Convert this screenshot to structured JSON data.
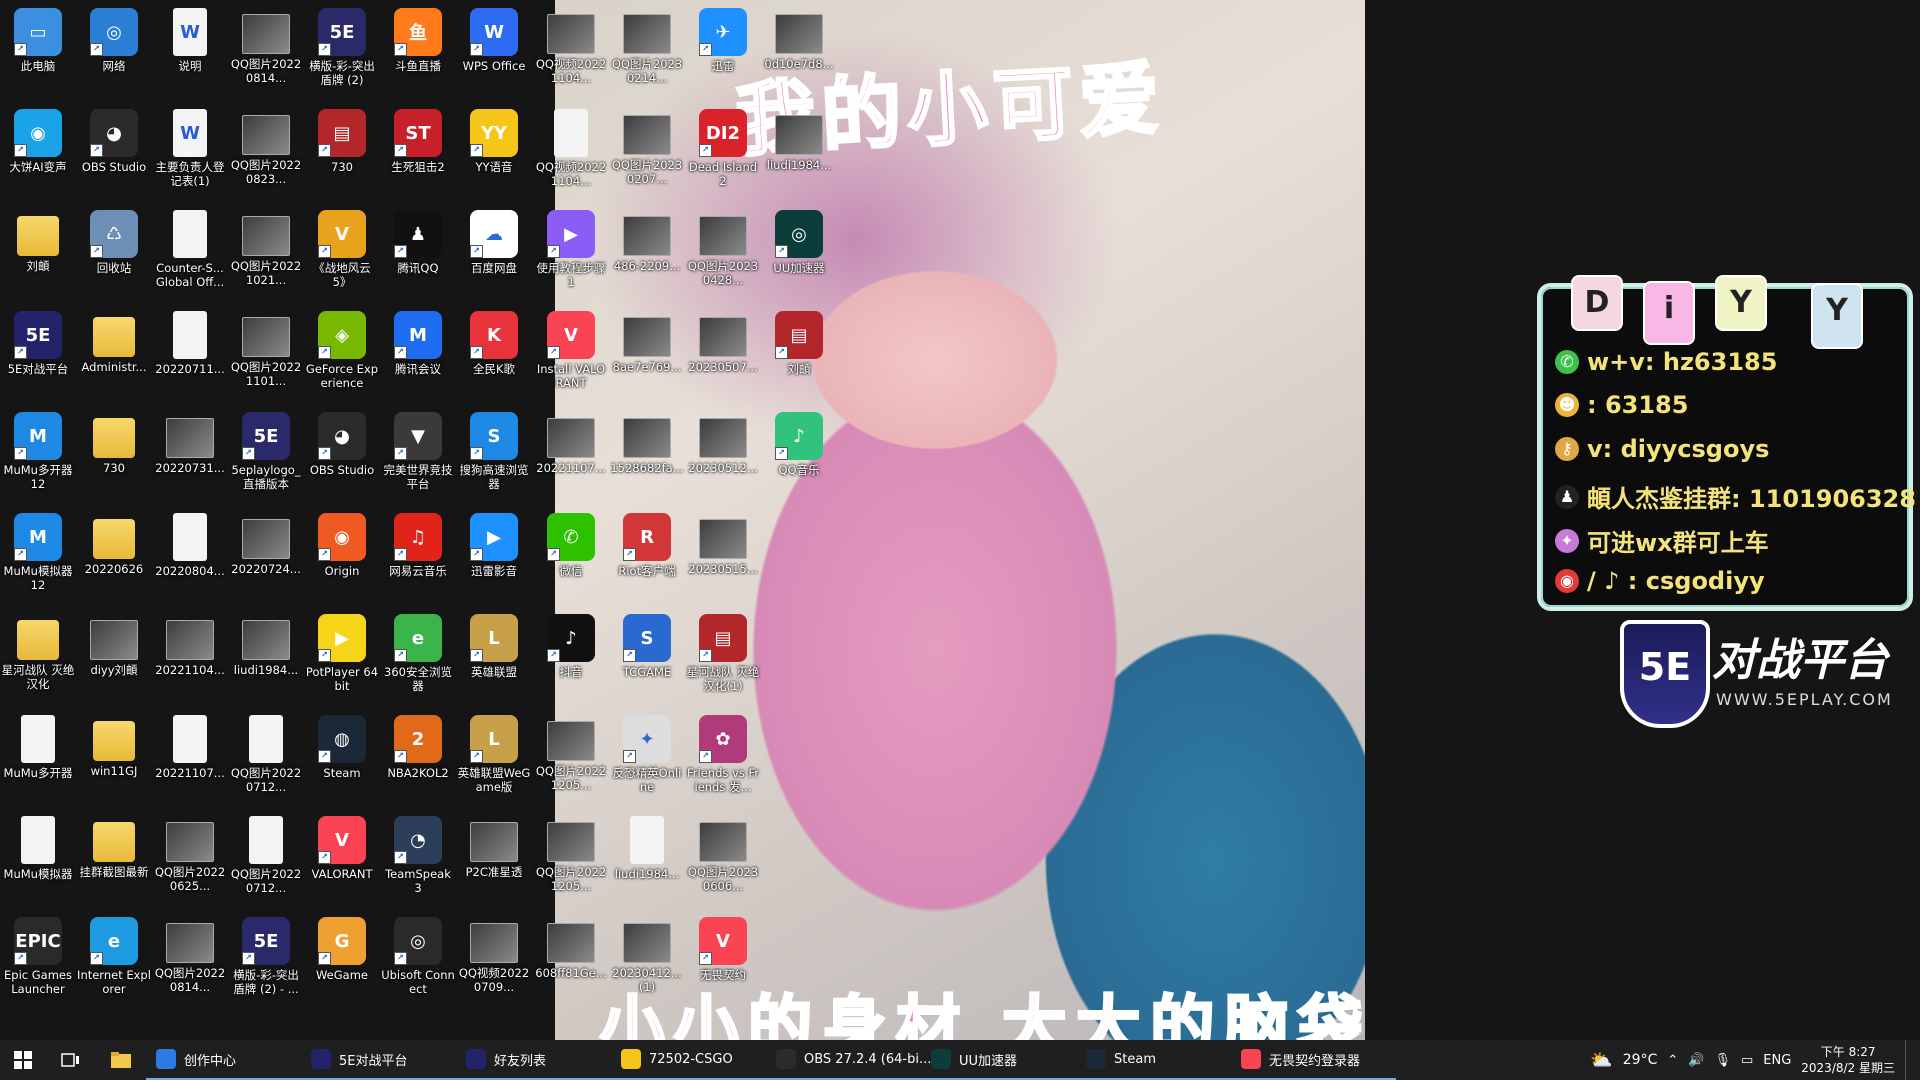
{
  "wallpaper": {
    "caption_top": "我的小可爱",
    "caption_bottom": "小小的身材 大大的脑袋"
  },
  "overlay": {
    "tags": [
      "D",
      "i",
      "Y",
      "Y"
    ],
    "tag_colors": [
      "#f5d7e3",
      "#f7b8e6",
      "#f0f4c4",
      "#cfe3f1"
    ],
    "lines": [
      {
        "icon": "wechat-icon",
        "color": "#3cc24a",
        "glyph": "✆",
        "text": "w+v:  hz63185"
      },
      {
        "icon": "qq-icon",
        "color": "#f0b33a",
        "glyph": "☻",
        "text": ": 63185"
      },
      {
        "icon": "key-icon",
        "color": "#e0a845",
        "glyph": "⚷",
        "text": "v:  diyycsgoys"
      },
      {
        "icon": "qq-penguin-icon",
        "color": "#222222",
        "glyph": "♟",
        "text": "頔人杰鉴挂群:  1101906328"
      },
      {
        "icon": "badge-icon",
        "color": "#c77ad8",
        "glyph": "✦",
        "text": "可进wx群可上车"
      },
      {
        "icon": "weibo-douyin-icon",
        "color": "#e03a3a",
        "glyph": "◉",
        "text": "/ ♪ :  csgodiyy"
      }
    ],
    "brand_title": "对战平台",
    "brand_shield": "5E",
    "brand_url": "WWW.5EPLAY.COM"
  },
  "desktop_icons": [
    {
      "label": "此电脑",
      "col": 0,
      "row": 0,
      "kind": "app",
      "color": "#3b8fe0",
      "glyph": "▭"
    },
    {
      "label": "网络",
      "col": 1,
      "row": 0,
      "kind": "app",
      "color": "#2a7fd4",
      "glyph": "◎"
    },
    {
      "label": "说明",
      "col": 2,
      "row": 0,
      "kind": "file",
      "glyph": "W"
    },
    {
      "label": "QQ图片20220814...",
      "col": 3,
      "row": 0,
      "kind": "img"
    },
    {
      "label": "横版-彩-突出盾牌 (2)",
      "col": 4,
      "row": 0,
      "kind": "app",
      "color": "#2a2a6a",
      "glyph": "5E"
    },
    {
      "label": "斗鱼直播",
      "col": 5,
      "row": 0,
      "kind": "app",
      "color": "#ff7a1a",
      "glyph": "鱼"
    },
    {
      "label": "WPS Office",
      "col": 6,
      "row": 0,
      "kind": "app",
      "color": "#2d6bf2",
      "glyph": "W"
    },
    {
      "label": "大饼AI变声",
      "col": 0,
      "row": 1,
      "kind": "app",
      "color": "#1aa3e8",
      "glyph": "◉"
    },
    {
      "label": "OBS Studio",
      "col": 1,
      "row": 1,
      "kind": "app",
      "color": "#2b2b2b",
      "glyph": "◕"
    },
    {
      "label": "主要负责人登记表(1)",
      "col": 2,
      "row": 1,
      "kind": "file",
      "glyph": "W"
    },
    {
      "label": "QQ图片20220823...",
      "col": 3,
      "row": 1,
      "kind": "img"
    },
    {
      "label": "730",
      "col": 4,
      "row": 1,
      "kind": "app",
      "color": "#b3262a",
      "glyph": "▤"
    },
    {
      "label": "生死狙击2",
      "col": 5,
      "row": 1,
      "kind": "app",
      "color": "#c8202a",
      "glyph": "ST"
    },
    {
      "label": "YY语音",
      "col": 6,
      "row": 1,
      "kind": "app",
      "color": "#f5c51a",
      "glyph": "YY"
    },
    {
      "label": "刘頔",
      "col": 0,
      "row": 2,
      "kind": "folder"
    },
    {
      "label": "回收站",
      "col": 1,
      "row": 2,
      "kind": "app",
      "color": "#6c8fb5",
      "glyph": "♺"
    },
    {
      "label": "Counter-S... Global Off...",
      "col": 2,
      "row": 2,
      "kind": "file",
      "glyph": ""
    },
    {
      "label": "QQ图片20221021...",
      "col": 3,
      "row": 2,
      "kind": "img"
    },
    {
      "label": "《战地风云 5》",
      "col": 4,
      "row": 2,
      "kind": "app",
      "color": "#e8a21c",
      "glyph": "V"
    },
    {
      "label": "腾讯QQ",
      "col": 5,
      "row": 2,
      "kind": "app",
      "color": "#111111",
      "glyph": "♟"
    },
    {
      "label": "百度网盘",
      "col": 6,
      "row": 2,
      "kind": "app",
      "color": "#ffffff",
      "glyph": "☁"
    },
    {
      "label": "5E对战平台",
      "col": 0,
      "row": 3,
      "kind": "app",
      "color": "#23236b",
      "glyph": "5E"
    },
    {
      "label": "Administr...",
      "col": 1,
      "row": 3,
      "kind": "folder"
    },
    {
      "label": "20220711...",
      "col": 2,
      "row": 3,
      "kind": "file",
      "glyph": ""
    },
    {
      "label": "QQ图片20221101...",
      "col": 3,
      "row": 3,
      "kind": "img"
    },
    {
      "label": "GeForce Experience",
      "col": 4,
      "row": 3,
      "kind": "app",
      "color": "#76b900",
      "glyph": "◈"
    },
    {
      "label": "腾讯会议",
      "col": 5,
      "row": 3,
      "kind": "app",
      "color": "#1e6cf0",
      "glyph": "M"
    },
    {
      "label": "全民K歌",
      "col": 6,
      "row": 3,
      "kind": "app",
      "color": "#e8323c",
      "glyph": "K"
    },
    {
      "label": "MuMu多开器12",
      "col": 0,
      "row": 4,
      "kind": "app",
      "color": "#1e88e5",
      "glyph": "M"
    },
    {
      "label": "730",
      "col": 1,
      "row": 4,
      "kind": "folder"
    },
    {
      "label": "20220731...",
      "col": 2,
      "row": 4,
      "kind": "img"
    },
    {
      "label": "5eplaylogo_直播版本",
      "col": 3,
      "row": 4,
      "kind": "app",
      "color": "#2a2a6a",
      "glyph": "5E"
    },
    {
      "label": "OBS Studio",
      "col": 4,
      "row": 4,
      "kind": "app",
      "color": "#2b2b2b",
      "glyph": "◕"
    },
    {
      "label": "完美世界竞技平台",
      "col": 5,
      "row": 4,
      "kind": "app",
      "color": "#3a3a3a",
      "glyph": "▼"
    },
    {
      "label": "搜狗高速浏览器",
      "col": 6,
      "row": 4,
      "kind": "app",
      "color": "#1e88e5",
      "glyph": "S"
    },
    {
      "label": "MuMu模拟器12",
      "col": 0,
      "row": 5,
      "kind": "app",
      "color": "#1e88e5",
      "glyph": "M"
    },
    {
      "label": "20220626",
      "col": 1,
      "row": 5,
      "kind": "folder"
    },
    {
      "label": "20220804...",
      "col": 2,
      "row": 5,
      "kind": "file",
      "glyph": ""
    },
    {
      "label": "20220724...",
      "col": 3,
      "row": 5,
      "kind": "img"
    },
    {
      "label": "Origin",
      "col": 4,
      "row": 5,
      "kind": "app",
      "color": "#f05a22",
      "glyph": "◉"
    },
    {
      "label": "网易云音乐",
      "col": 5,
      "row": 5,
      "kind": "app",
      "color": "#e2231a",
      "glyph": "♫"
    },
    {
      "label": "迅雷影音",
      "col": 6,
      "row": 5,
      "kind": "app",
      "color": "#1e90ff",
      "glyph": "▶"
    },
    {
      "label": "星河战队 灭绝汉化",
      "col": 0,
      "row": 6,
      "kind": "folder"
    },
    {
      "label": "diyy刘頔",
      "col": 1,
      "row": 6,
      "kind": "img"
    },
    {
      "label": "20221104...",
      "col": 2,
      "row": 6,
      "kind": "img"
    },
    {
      "label": "liudi1984...",
      "col": 3,
      "row": 6,
      "kind": "img"
    },
    {
      "label": "PotPlayer 64 bit",
      "col": 4,
      "row": 6,
      "kind": "app",
      "color": "#f5d41a",
      "glyph": "▶"
    },
    {
      "label": "360安全浏览器",
      "col": 5,
      "row": 6,
      "kind": "app",
      "color": "#3bb54a",
      "glyph": "e"
    },
    {
      "label": "英雄联盟",
      "col": 6,
      "row": 6,
      "kind": "app",
      "color": "#c8a04a",
      "glyph": "L"
    },
    {
      "label": "MuMu多开器",
      "col": 0,
      "row": 7,
      "kind": "file",
      "glyph": ""
    },
    {
      "label": "win11GJ",
      "col": 1,
      "row": 7,
      "kind": "folder"
    },
    {
      "label": "20221107...",
      "col": 2,
      "row": 7,
      "kind": "file",
      "glyph": ""
    },
    {
      "label": "QQ图片20220712...",
      "col": 3,
      "row": 7,
      "kind": "file",
      "glyph": ""
    },
    {
      "label": "Steam",
      "col": 4,
      "row": 7,
      "kind": "app",
      "color": "#1b2838",
      "glyph": "◍"
    },
    {
      "label": "NBA2KOL2",
      "col": 5,
      "row": 7,
      "kind": "app",
      "color": "#e06a1a",
      "glyph": "2"
    },
    {
      "label": "英雄联盟WeGame版",
      "col": 6,
      "row": 7,
      "kind": "app",
      "color": "#c8a04a",
      "glyph": "L"
    },
    {
      "label": "MuMu模拟器",
      "col": 0,
      "row": 8,
      "kind": "file",
      "glyph": ""
    },
    {
      "label": "挂群截图最新",
      "col": 1,
      "row": 8,
      "kind": "folder"
    },
    {
      "label": "QQ图片20220625...",
      "col": 2,
      "row": 8,
      "kind": "img"
    },
    {
      "label": "QQ图片20220712...",
      "col": 3,
      "row": 8,
      "kind": "file",
      "glyph": ""
    },
    {
      "label": "VALORANT",
      "col": 4,
      "row": 8,
      "kind": "app",
      "color": "#fa4454",
      "glyph": "V"
    },
    {
      "label": "TeamSpeak 3",
      "col": 5,
      "row": 8,
      "kind": "app",
      "color": "#2c3e5a",
      "glyph": "◔"
    },
    {
      "label": "P2C准星透",
      "col": 6,
      "row": 8,
      "kind": "img"
    },
    {
      "label": "Epic Games Launcher",
      "col": 0,
      "row": 9,
      "kind": "app",
      "color": "#2a2a2a",
      "glyph": "EPIC"
    },
    {
      "label": "Internet Explorer",
      "col": 1,
      "row": 9,
      "kind": "app",
      "color": "#1e9ae0",
      "glyph": "e"
    },
    {
      "label": "QQ图片20220814...",
      "col": 2,
      "row": 9,
      "kind": "img"
    },
    {
      "label": "横版-彩-突出盾牌 (2) - ...",
      "col": 3,
      "row": 9,
      "kind": "app",
      "color": "#2a2a6a",
      "glyph": "5E"
    },
    {
      "label": "WeGame",
      "col": 4,
      "row": 9,
      "kind": "app",
      "color": "#f0a030",
      "glyph": "G"
    },
    {
      "label": "Ubisoft Connect",
      "col": 5,
      "row": 9,
      "kind": "app",
      "color": "#2a2a2a",
      "glyph": "◎"
    },
    {
      "label": "QQ视频20220709...",
      "col": 6,
      "row": 9,
      "kind": "img"
    },
    {
      "label": "QQ视频20221104...",
      "col": 7,
      "row": 0,
      "kind": "img"
    },
    {
      "label": "QQ图片20230214...",
      "col": 8,
      "row": 0,
      "kind": "img"
    },
    {
      "label": "迅雷",
      "col": 9,
      "row": 0,
      "kind": "app",
      "color": "#1e90ff",
      "glyph": "✈"
    },
    {
      "label": "0d10e7d8...",
      "col": 10,
      "row": 0,
      "kind": "img"
    },
    {
      "label": "QQ视频20221104...",
      "col": 7,
      "row": 1,
      "kind": "file",
      "glyph": ""
    },
    {
      "label": "QQ图片20230207...",
      "col": 8,
      "row": 1,
      "kind": "img"
    },
    {
      "label": "Dead Island 2",
      "col": 9,
      "row": 1,
      "kind": "app",
      "color": "#d8232a",
      "glyph": "DI2"
    },
    {
      "label": "liudi1984...",
      "col": 10,
      "row": 1,
      "kind": "img"
    },
    {
      "label": "使用教程步骤1",
      "col": 7,
      "row": 2,
      "kind": "app",
      "color": "#8b5cf6",
      "glyph": "▶"
    },
    {
      "label": "486-2209...",
      "col": 8,
      "row": 2,
      "kind": "img"
    },
    {
      "label": "QQ图片20230428...",
      "col": 9,
      "row": 2,
      "kind": "img"
    },
    {
      "label": "UU加速器",
      "col": 10,
      "row": 2,
      "kind": "app",
      "color": "#0b3d3a",
      "glyph": "◎"
    },
    {
      "label": "Install VALORANT",
      "col": 7,
      "row": 3,
      "kind": "app",
      "color": "#fa4454",
      "glyph": "V"
    },
    {
      "label": "8ae7e769...",
      "col": 8,
      "row": 3,
      "kind": "img"
    },
    {
      "label": "20230507...",
      "col": 9,
      "row": 3,
      "kind": "img"
    },
    {
      "label": "刘頔",
      "col": 10,
      "row": 3,
      "kind": "app",
      "color": "#b3262a",
      "glyph": "▤"
    },
    {
      "label": "20221107...",
      "col": 7,
      "row": 4,
      "kind": "img"
    },
    {
      "label": "1528682fa...",
      "col": 8,
      "row": 4,
      "kind": "img"
    },
    {
      "label": "20230512...",
      "col": 9,
      "row": 4,
      "kind": "img"
    },
    {
      "label": "QQ音乐",
      "col": 10,
      "row": 4,
      "kind": "app",
      "color": "#31c27c",
      "glyph": "♪"
    },
    {
      "label": "微信",
      "col": 7,
      "row": 5,
      "kind": "app",
      "color": "#2dc100",
      "glyph": "✆"
    },
    {
      "label": "Riot客户端",
      "col": 8,
      "row": 5,
      "kind": "app",
      "color": "#d13639",
      "glyph": "R"
    },
    {
      "label": "20230515...",
      "col": 9,
      "row": 5,
      "kind": "img"
    },
    {
      "label": "抖音",
      "col": 7,
      "row": 6,
      "kind": "app",
      "color": "#111111",
      "glyph": "♪"
    },
    {
      "label": "TCGAME",
      "col": 8,
      "row": 6,
      "kind": "app",
      "color": "#2a6ad0",
      "glyph": "S"
    },
    {
      "label": "星河战队 灭绝汉化(1)",
      "col": 9,
      "row": 6,
      "kind": "app",
      "color": "#b3262a",
      "glyph": "▤"
    },
    {
      "label": "QQ图片20221205...",
      "col": 7,
      "row": 7,
      "kind": "img"
    },
    {
      "label": "反恐精英Online",
      "col": 8,
      "row": 7,
      "kind": "app",
      "color": "#dddddd",
      "glyph": "✦"
    },
    {
      "label": "Friends vs Friends 发...",
      "col": 9,
      "row": 7,
      "kind": "app",
      "color": "#b03a7a",
      "glyph": "✿"
    },
    {
      "label": "QQ图片20221205...",
      "col": 7,
      "row": 8,
      "kind": "img"
    },
    {
      "label": "liudi1984...",
      "col": 8,
      "row": 8,
      "kind": "file",
      "glyph": ""
    },
    {
      "label": "QQ图片20230606...",
      "col": 9,
      "row": 8,
      "kind": "img"
    },
    {
      "label": "608ff81Ge...",
      "col": 7,
      "row": 9,
      "kind": "img"
    },
    {
      "label": "20230412... (1)",
      "col": 8,
      "row": 9,
      "kind": "img"
    },
    {
      "label": "无畏契约",
      "col": 9,
      "row": 9,
      "kind": "app",
      "color": "#fa4454",
      "glyph": "V"
    }
  ],
  "taskbar": {
    "apps": [
      {
        "label": "创作中心",
        "color": "#2c7be5",
        "width": 155
      },
      {
        "label": "5E对战平台",
        "color": "#23236b",
        "width": 155
      },
      {
        "label": "好友列表",
        "color": "#23236b",
        "width": 155
      },
      {
        "label": "72502-CSGO",
        "color": "#f5c51a",
        "width": 155
      },
      {
        "label": "OBS 27.2.4 (64-bi...",
        "color": "#2b2b2b",
        "width": 155
      },
      {
        "label": "UU加速器",
        "color": "#0b3d3a",
        "width": 155
      },
      {
        "label": "Steam",
        "color": "#1b2838",
        "width": 155
      },
      {
        "label": "无畏契约登录器",
        "color": "#fa4454",
        "width": 165
      }
    ],
    "weather": "29°C",
    "lang": "ENG",
    "time": "下午 8:27",
    "date": "2023/8/2 星期三"
  }
}
